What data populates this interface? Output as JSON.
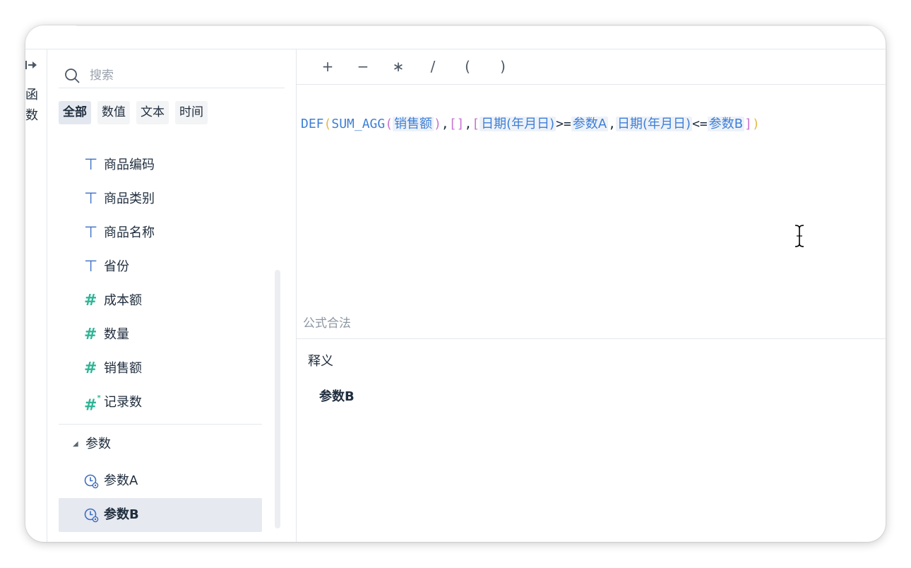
{
  "sidebar": {
    "label": "函数"
  },
  "search": {
    "placeholder": "搜索",
    "value": ""
  },
  "filters": [
    {
      "label": "全部",
      "active": true
    },
    {
      "label": "数值",
      "active": false
    },
    {
      "label": "文本",
      "active": false
    },
    {
      "label": "时间",
      "active": false
    }
  ],
  "fields": [
    {
      "label": "商品编码",
      "type": "text",
      "icon": "text-type-icon"
    },
    {
      "label": "商品类别",
      "type": "text",
      "icon": "text-type-icon"
    },
    {
      "label": "商品名称",
      "type": "text",
      "icon": "text-type-icon"
    },
    {
      "label": "省份",
      "type": "text",
      "icon": "text-type-icon"
    },
    {
      "label": "成本额",
      "type": "number",
      "icon": "number-type-icon"
    },
    {
      "label": "数量",
      "type": "number",
      "icon": "number-type-icon"
    },
    {
      "label": "销售额",
      "type": "number",
      "icon": "number-type-icon"
    },
    {
      "label": "记录数",
      "type": "number-calc",
      "icon": "record-count-icon"
    }
  ],
  "params_group": {
    "label": "参数",
    "items": [
      {
        "label": "参数A",
        "selected": false,
        "icon": "parameter-clock-icon"
      },
      {
        "label": "参数B",
        "selected": true,
        "icon": "parameter-clock-icon"
      }
    ]
  },
  "operators": [
    "+",
    "−",
    "∗",
    "/",
    "(",
    ")"
  ],
  "formula": {
    "fn_def": "DEF",
    "fn_sum": "SUM_AGG",
    "f_sales": "销售额",
    "empty_list": "[]",
    "f_date1": "日期(年月日)",
    "op_ge": ">=",
    "p_a": "参数A",
    "f_date2": "日期(年月日)",
    "op_le": "<=",
    "p_b": "参数B"
  },
  "status": "公式合法",
  "description": {
    "title": "释义",
    "name": "参数B"
  },
  "colors": {
    "text_icon": "#3c6ec3",
    "number_icon": "#2fb596",
    "function": "#3d7fd6",
    "selected_bg": "#e6e9f0"
  }
}
